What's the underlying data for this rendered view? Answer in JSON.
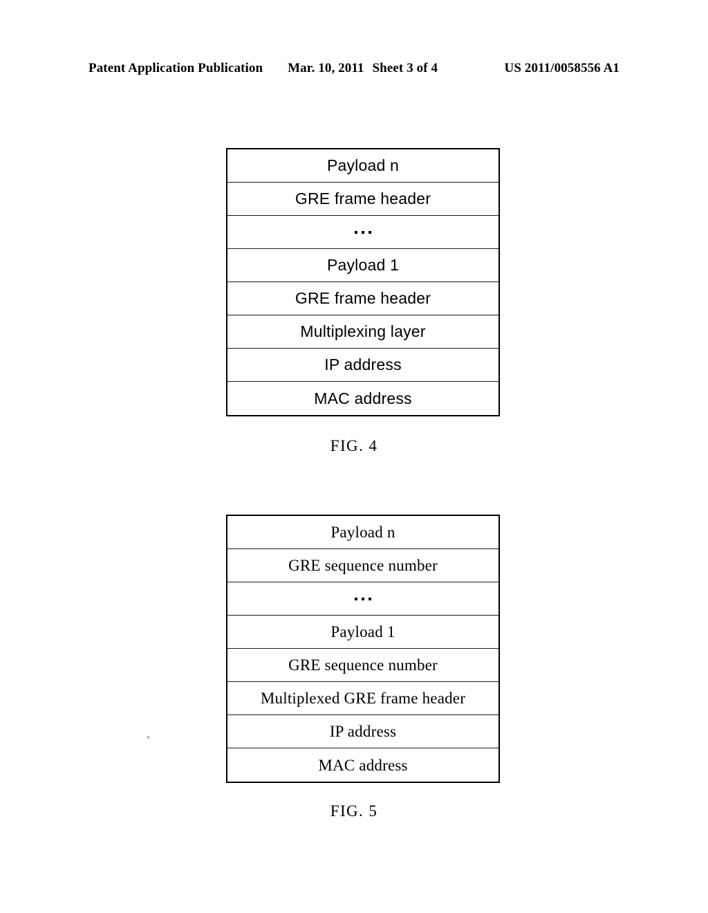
{
  "header": {
    "publication_label": "Patent Application Publication",
    "date": "Mar. 10, 2011",
    "sheet": "Sheet 3 of 4",
    "publication_number": "US 2011/0058556 A1"
  },
  "figures": [
    {
      "id": "figure-4",
      "caption": "FIG. 4",
      "rows": [
        {
          "label": "Payload n",
          "type": "text"
        },
        {
          "label": "GRE frame header",
          "type": "text"
        },
        {
          "label": "...",
          "type": "ellipsis"
        },
        {
          "label": "Payload 1",
          "type": "text"
        },
        {
          "label": "GRE frame header",
          "type": "text"
        },
        {
          "label": "Multiplexing layer",
          "type": "text"
        },
        {
          "label": "IP address",
          "type": "text"
        },
        {
          "label": "MAC address",
          "type": "text"
        }
      ]
    },
    {
      "id": "figure-5",
      "caption": "FIG. 5",
      "rows": [
        {
          "label": "Payload n",
          "type": "text"
        },
        {
          "label": "GRE sequence number",
          "type": "text"
        },
        {
          "label": "...",
          "type": "ellipsis"
        },
        {
          "label": "Payload 1",
          "type": "text"
        },
        {
          "label": "GRE sequence number",
          "type": "text"
        },
        {
          "label": "Multiplexed GRE frame header",
          "type": "text"
        },
        {
          "label": "IP address",
          "type": "text"
        },
        {
          "label": "MAC address",
          "type": "text"
        }
      ]
    }
  ],
  "colors": {
    "ink": "#000000",
    "paper": "#ffffff",
    "rule": "#1a1a1a"
  }
}
